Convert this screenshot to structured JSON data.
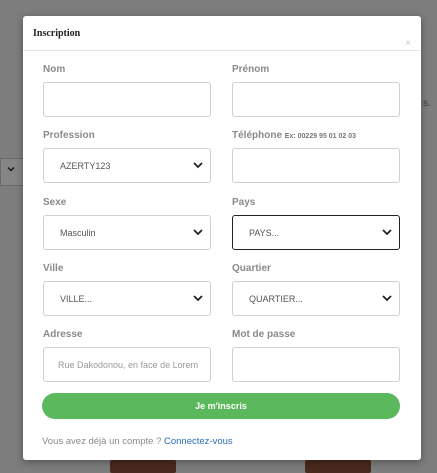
{
  "modal": {
    "title": "Inscription",
    "close_icon": "×"
  },
  "form": {
    "nom": {
      "label": "Nom",
      "value": ""
    },
    "prenom": {
      "label": "Prénom",
      "value": ""
    },
    "profession": {
      "label": "Profession",
      "value": "AZERTY123"
    },
    "telephone": {
      "label": "Téléphone",
      "hint": "Ex: 00229 95 01 02 03",
      "value": ""
    },
    "sexe": {
      "label": "Sexe",
      "value": "Masculin"
    },
    "pays": {
      "label": "Pays",
      "value": "PAYS..."
    },
    "ville": {
      "label": "Ville",
      "value": "VILLE..."
    },
    "quartier": {
      "label": "Quartier",
      "value": "QUARTIER..."
    },
    "adresse": {
      "label": "Adresse",
      "placeholder": "Rue Dakodonou, en face de Lorem"
    },
    "mot_de_passe": {
      "label": "Mot de passe",
      "value": ""
    }
  },
  "submit_label": "Je m'inscris",
  "footer": {
    "prompt": "Vous avez déjà un compte ?",
    "link": "Connectez-vous"
  },
  "colors": {
    "primary_button": "#5cb85c",
    "link": "#2a6db5",
    "overlay": "#7d7d7d"
  }
}
